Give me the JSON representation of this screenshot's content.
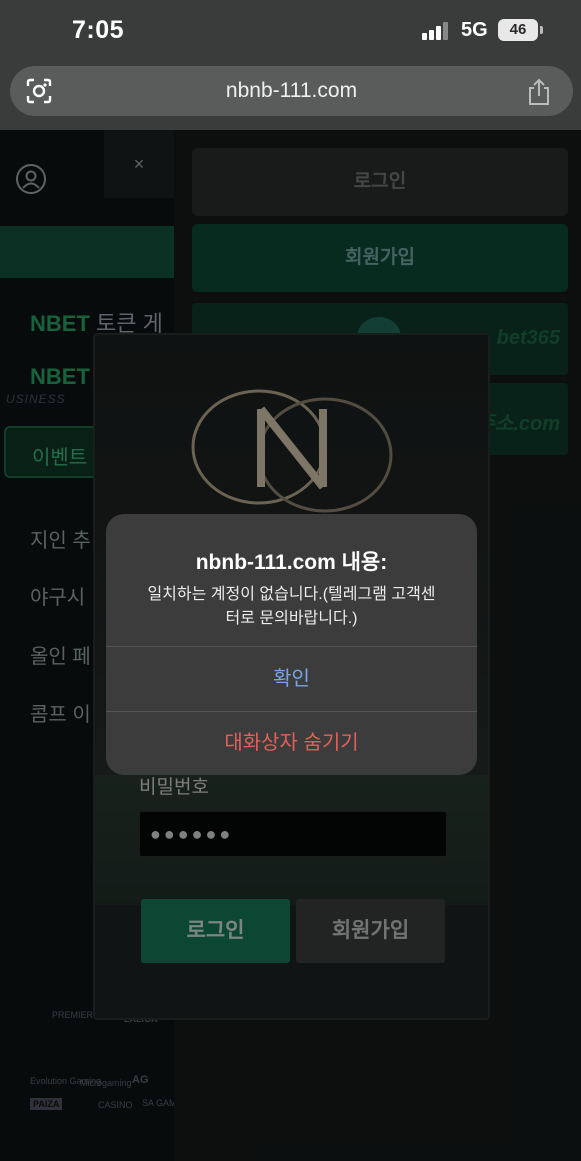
{
  "status_bar": {
    "time": "7:05",
    "network": "5G",
    "battery": "46"
  },
  "browser": {
    "url": "nbnb-111.com",
    "lens_icon": "lens-icon",
    "share_icon": "share-icon"
  },
  "menu": {
    "close_label": "×",
    "brand_lines": [
      {
        "prefix": "NBET",
        "text": " 토큰 게"
      },
      {
        "prefix": "NBET",
        "text": ""
      }
    ],
    "business_label": "USINESS",
    "event_tab": "이벤트",
    "items": [
      "지인 추",
      "야구시",
      "올인 페",
      "콤프 이"
    ],
    "sponsors": [
      "PREMIER LEAGUE",
      "LALIGA",
      "Evolution Gaming",
      "Microgaming",
      "AG",
      "PAIZA",
      "CASINO",
      "SA GAMING"
    ]
  },
  "header_buttons": {
    "login": "로그인",
    "signup": "회원가입"
  },
  "banners": [
    "bet365",
    "주소.com"
  ],
  "login_panel": {
    "password_label": "비밀번호",
    "password_value": "●●●●●●",
    "login_button": "로그인",
    "signup_button": "회원가입"
  },
  "alert": {
    "title": "nbnb-111.com 내용:",
    "message": "일치하는 계정이 없습니다.(텔레그램 고객센터로 문의바랍니다.)",
    "confirm": "확인",
    "hide_dialog": "대화상자 숨기기"
  },
  "colors": {
    "accent_green": "#157a58",
    "alert_confirm": "#7aa4e6",
    "alert_destructive": "#e0605a"
  }
}
